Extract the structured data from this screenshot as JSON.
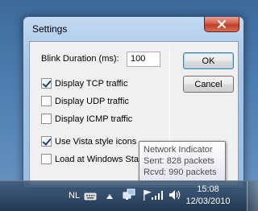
{
  "window": {
    "title": "Settings",
    "close_icon": "close-icon"
  },
  "settings": {
    "blink_label": "Blink Duration (ms):",
    "blink_value": "100",
    "checkboxes": [
      {
        "label": "Display TCP traffic",
        "checked": true
      },
      {
        "label": "Display UDP traffic",
        "checked": false
      },
      {
        "label": "Display ICMP traffic",
        "checked": false
      },
      {
        "label": "Use Vista style icons",
        "checked": true
      },
      {
        "label": "Load at Windows Star",
        "checked": false
      }
    ],
    "ok_label": "OK",
    "cancel_label": "Cancel"
  },
  "tooltip": {
    "title": "Network Indicator",
    "sent": "Sent: 828 packets",
    "rcvd": "Rcvd: 990 packets"
  },
  "taskbar": {
    "language": "NL",
    "time": "15:08",
    "date": "12/03/2010",
    "icons": [
      "keyboard-icon",
      "show-hidden-icons-arrow",
      "network-indicator-icon",
      "flag-icon",
      "signal-strength-icon",
      "volume-icon"
    ]
  }
}
